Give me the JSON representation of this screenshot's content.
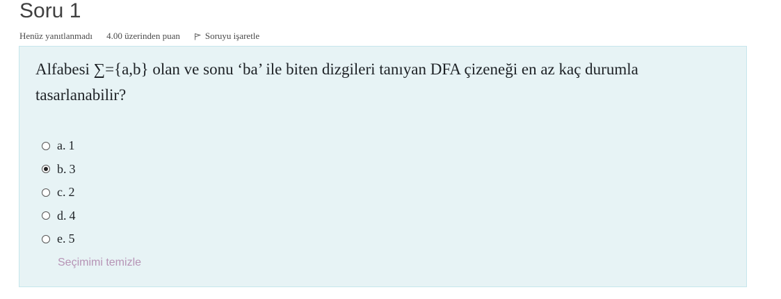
{
  "question": {
    "title": "Soru 1",
    "state": "Henüz yanıtlanmadı",
    "grade": "4.00 üzerinden puan",
    "flag_label": "Soruyu işaretle",
    "text": "Alfabesi ∑={a,b} olan ve sonu ‘ba’ ile biten dizgileri tanıyan DFA çizeneği en az kaç durumla tasarlanabilir?"
  },
  "answers": [
    {
      "letter": "a.",
      "value": "1",
      "checked": false
    },
    {
      "letter": "b.",
      "value": "3",
      "checked": true
    },
    {
      "letter": "c.",
      "value": "2",
      "checked": false
    },
    {
      "letter": "d.",
      "value": "4",
      "checked": false
    },
    {
      "letter": "e.",
      "value": "5",
      "checked": false
    }
  ],
  "clear_choice_label": "Seçimimi temizle",
  "colors": {
    "question_bg": "#e7f3f5",
    "question_border": "#c6e6ec",
    "clear_link": "#b693b5"
  }
}
